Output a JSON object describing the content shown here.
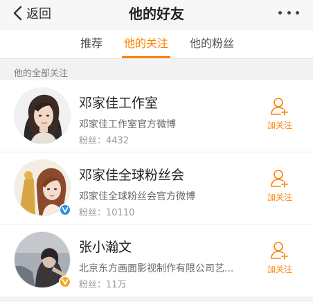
{
  "header": {
    "back_label": "返回",
    "title": "他的好友",
    "more_icon": "more-dots-icon"
  },
  "tabs": [
    {
      "label": "推荐",
      "active": false
    },
    {
      "label": "他的关注",
      "active": true
    },
    {
      "label": "他的粉丝",
      "active": false
    }
  ],
  "colors": {
    "accent": "#ff8200",
    "verified_blue": "#2f8fe6",
    "verified_gold": "#f5a623"
  },
  "section": {
    "title": "他的全部关注"
  },
  "users": [
    {
      "name": "邓家佳工作室",
      "description": "邓家佳工作室官方微博",
      "fans": "粉丝：4432",
      "verified": null,
      "follow_label": "加关注",
      "follow_icon": "add-user-icon"
    },
    {
      "name": "邓家佳全球粉丝会",
      "description": "邓家佳全球粉丝会官方微博",
      "fans": "粉丝：10110",
      "verified": "blue",
      "follow_label": "加关注",
      "follow_icon": "add-user-icon"
    },
    {
      "name": "张小瀚文",
      "description": "北京东方画面影视制作有限公司艺...",
      "fans": "粉丝：11万",
      "verified": "gold",
      "follow_label": "加关注",
      "follow_icon": "add-user-icon"
    }
  ]
}
